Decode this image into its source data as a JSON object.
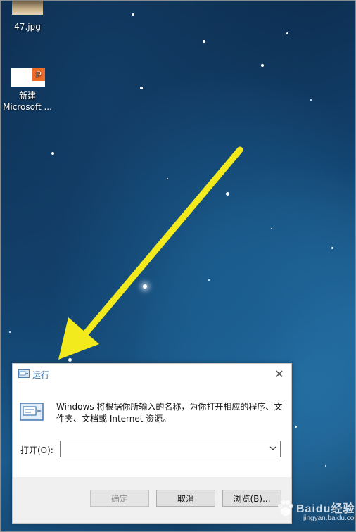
{
  "desktop": {
    "icons": [
      {
        "label": "47.jpg"
      },
      {
        "label_line1": "新建",
        "label_line2": "Microsoft ...",
        "badge": "P"
      }
    ]
  },
  "run_dialog": {
    "title": "运行",
    "description": "Windows 将根据你所输入的名称，为你打开相应的程序、文件夹、文档或 Internet 资源。",
    "open_label": "打开(O):",
    "open_value": "",
    "buttons": {
      "ok": "确定",
      "cancel": "取消",
      "browse": "浏览(B)..."
    }
  },
  "watermark": {
    "brand": "Baidu经验",
    "domain": "jingyan.baidu.com"
  },
  "colors": {
    "arrow": "#f2ea1c",
    "title_text": "#3a6fa8",
    "footer_bg": "#f0f0f0"
  }
}
